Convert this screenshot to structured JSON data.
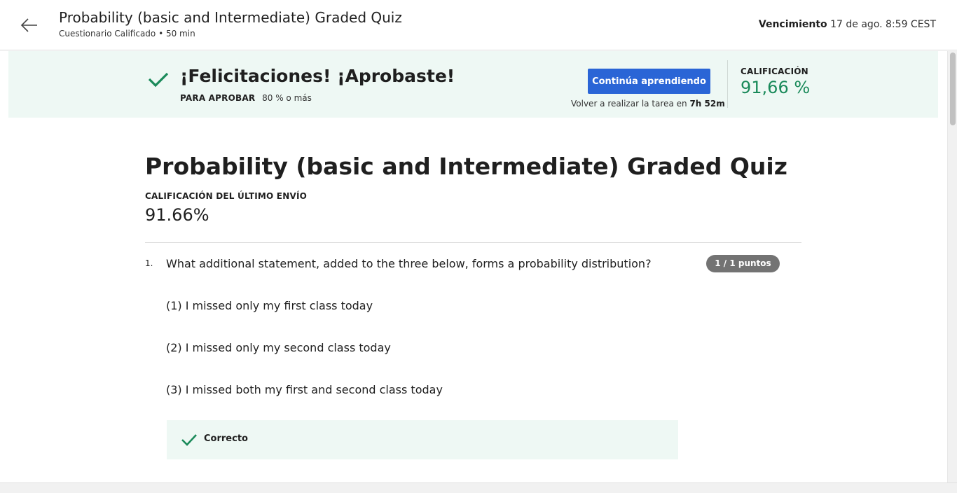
{
  "header": {
    "title": "Probability (basic and Intermediate) Graded Quiz",
    "subtitle": "Cuestionario Calificado • 50 min",
    "due_label": "Vencimiento",
    "due_value": "17 de ago. 8:59 CEST"
  },
  "banner": {
    "headline": "¡Felicitaciones! ¡Aprobaste!",
    "pass_label": "PARA APROBAR",
    "pass_value": "80 % o más",
    "continue_label": "Continúa aprendiendo",
    "retry_text": "Volver a realizar la tarea en",
    "retry_time": "7h 52m",
    "grade_label": "CALIFICACIÓN",
    "grade_value": "91,66 %",
    "success_color": "#1a8a5a",
    "button_color": "#2a65d6"
  },
  "main": {
    "quiz_title": "Probability (basic and Intermediate) Graded Quiz",
    "last_submission_label": "CALIFICACIÓN DEL ÚLTIMO ENVÍO",
    "last_submission_value": "91.66%"
  },
  "questions": [
    {
      "number": "1.",
      "text": "What additional statement, added to the three below, forms a probability distribution?",
      "points": "1 / 1 puntos",
      "statements": [
        "(1) I missed only my first class today",
        "(2) I missed only my second class today",
        "(3) I missed both my first and second class today"
      ],
      "feedback": "Correcto"
    }
  ],
  "icons": {
    "back": "arrow-left-icon",
    "success": "check-icon"
  }
}
